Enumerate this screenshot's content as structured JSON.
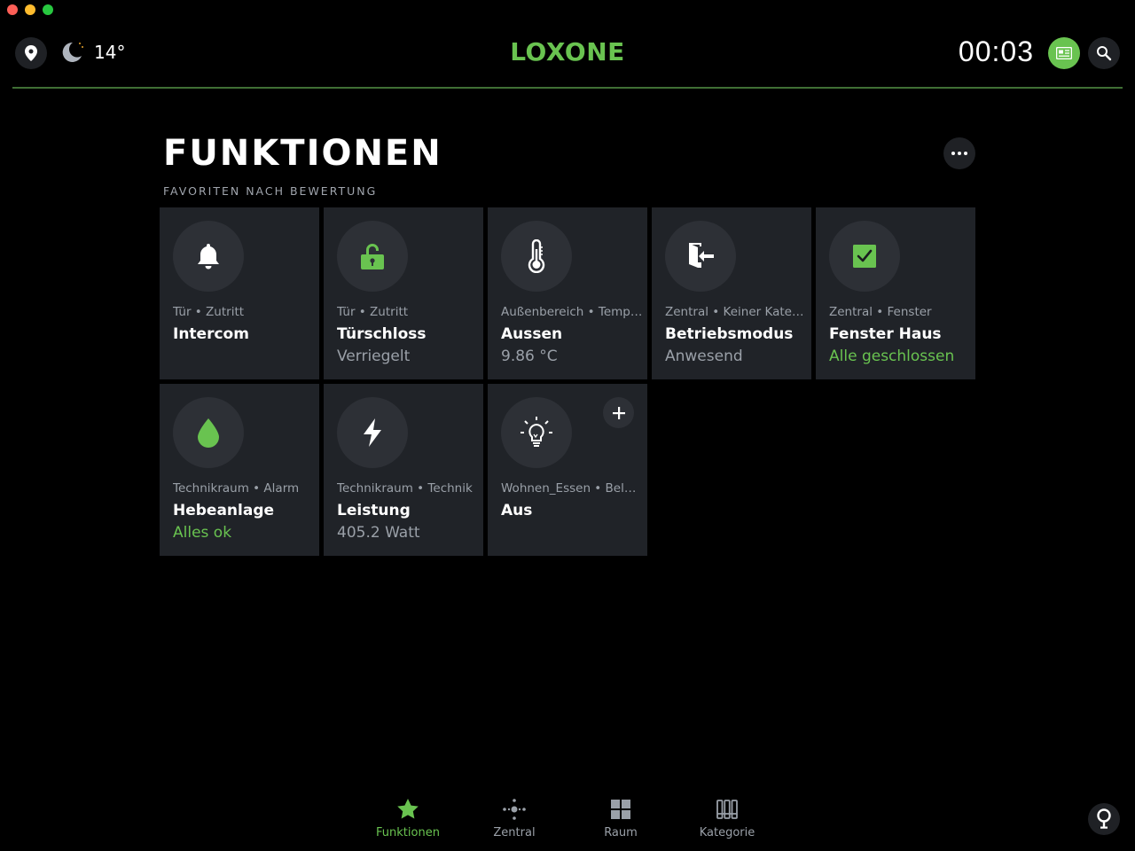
{
  "header": {
    "temperature": "14°",
    "logo": "LOXONE",
    "clock": "00:03"
  },
  "page": {
    "title": "FUNKTIONEN",
    "subtitle": "FAVORITEN NACH BEWERTUNG"
  },
  "tiles": [
    {
      "category": "Tür • Zutritt",
      "name": "Intercom",
      "state": "",
      "icon": "bell-icon"
    },
    {
      "category": "Tür • Zutritt",
      "name": "Türschloss",
      "state": "Verriegelt",
      "icon": "unlocked-padlock-icon"
    },
    {
      "category": "Außenbereich • Tempe…",
      "name": "Aussen",
      "state": "9.86 °C",
      "icon": "thermometer-icon"
    },
    {
      "category": "Zentral • Keiner Kateg…",
      "name": "Betriebsmodus",
      "state": "Anwesend",
      "icon": "door-enter-icon"
    },
    {
      "category": "Zentral • Fenster",
      "name": "Fenster Haus",
      "state": "Alle geschlossen",
      "icon": "checkbox-icon"
    },
    {
      "category": "Technikraum • Alarm",
      "name": "Hebeanlage",
      "state": "Alles ok",
      "icon": "water-drop-icon"
    },
    {
      "category": "Technikraum • Technik",
      "name": "Leistung",
      "state": "405.2 Watt",
      "icon": "lightning-icon"
    },
    {
      "category": "Wohnen_Essen • Bele…",
      "name": "Aus",
      "state": "",
      "icon": "lightbulb-icon"
    }
  ],
  "nav": [
    {
      "label": "Funktionen",
      "icon": "star-icon",
      "active": true
    },
    {
      "label": "Zentral",
      "icon": "central-icon"
    },
    {
      "label": "Raum",
      "icon": "room-grid-icon"
    },
    {
      "label": "Kategorie",
      "icon": "category-icon"
    }
  ],
  "colors": {
    "accent": "#69c350",
    "tile_bg": "#202328",
    "icon_circle": "#2d3036"
  }
}
